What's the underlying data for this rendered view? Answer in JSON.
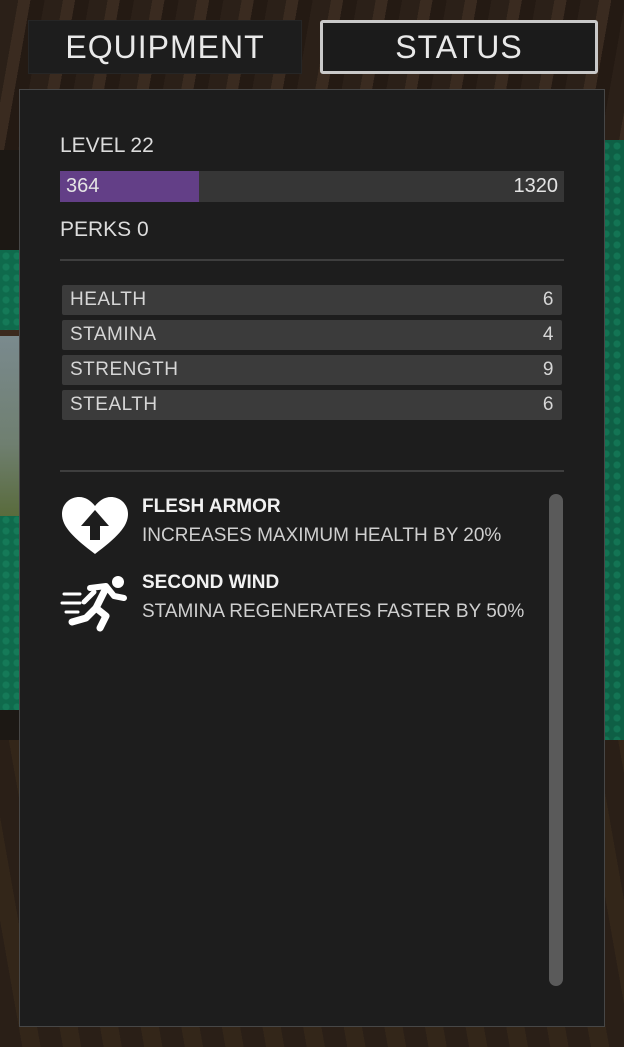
{
  "tabs": {
    "equipment": "EQUIPMENT",
    "status": "STATUS",
    "active": "STATUS"
  },
  "level": {
    "label": "LEVEL 22",
    "xp_current": "364",
    "xp_max": "1320",
    "xp_fraction": 0.276
  },
  "perks_count_label": "PERKS 0",
  "stats": [
    {
      "name": "HEALTH",
      "value": "6"
    },
    {
      "name": "STAMINA",
      "value": "4"
    },
    {
      "name": "STRENGTH",
      "value": "9"
    },
    {
      "name": "STEALTH",
      "value": "6"
    }
  ],
  "perks": [
    {
      "name": "FLESH ARMOR",
      "description": "INCREASES MAXIMUM HEALTH BY 20%",
      "icon": "heart-up-icon"
    },
    {
      "name": "SECOND WIND",
      "description": "STAMINA REGENERATES FASTER BY 50%",
      "icon": "running-man-icon"
    }
  ],
  "colors": {
    "xp_fill": "#633f87",
    "panel_bg": "#1d1d1d",
    "stat_bg": "#3b3b3b"
  }
}
